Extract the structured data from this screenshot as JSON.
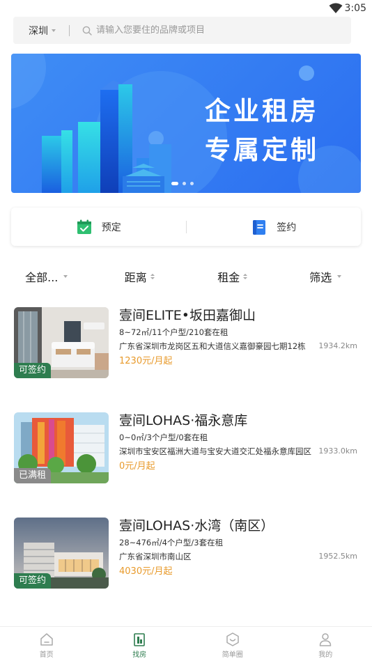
{
  "status_bar": {
    "time": "3:05",
    "icon": "wifi-icon"
  },
  "search": {
    "city": "深圳",
    "placeholder": "请输入您要住的品牌或项目"
  },
  "banner": {
    "line1": "企业租房",
    "line2": "专属定制",
    "slide_count": 3,
    "active_slide": 1
  },
  "actions": [
    {
      "label": "预定",
      "icon": "calendar-check-icon"
    },
    {
      "label": "签约",
      "icon": "document-icon"
    }
  ],
  "filters": [
    {
      "label": "全部...",
      "indicator": "caret-down"
    },
    {
      "label": "距离",
      "indicator": "sort"
    },
    {
      "label": "租金",
      "indicator": "sort"
    },
    {
      "label": "筛选",
      "indicator": "caret-down"
    }
  ],
  "listings": [
    {
      "title": "壹间ELITE•坂田嘉御山",
      "meta": "8~72㎡/11个户型/210套在租",
      "address": "广东省深圳市龙岗区五和大道信义嘉御豪园七期12栋",
      "distance": "1934.2km",
      "price": "1230元/月起",
      "badge": "可签约"
    },
    {
      "title": "壹间LOHAS·福永意库",
      "meta": "0~0㎡/3个户型/0套在租",
      "address": "深圳市宝安区福洲大道与宝安大道交汇处福永意库园区",
      "distance": "1933.0km",
      "price": "0元/月起",
      "badge": "已满租"
    },
    {
      "title": "壹间LOHAS·水湾（南区）",
      "meta": "28~476㎡/4个户型/3套在租",
      "address": "广东省深圳市南山区",
      "distance": "1952.5km",
      "price": "4030元/月起",
      "badge": "可签约"
    }
  ],
  "tabbar": [
    {
      "label": "首页",
      "icon": "home-icon",
      "active": false
    },
    {
      "label": "找房",
      "icon": "find-room-icon",
      "active": true
    },
    {
      "label": "简单圈",
      "icon": "circle-icon",
      "active": false
    },
    {
      "label": "我的",
      "icon": "profile-icon",
      "active": false
    }
  ],
  "colors": {
    "accent": "#2e7d4f",
    "price": "#e89a2b",
    "banner": "#3f8df5"
  }
}
